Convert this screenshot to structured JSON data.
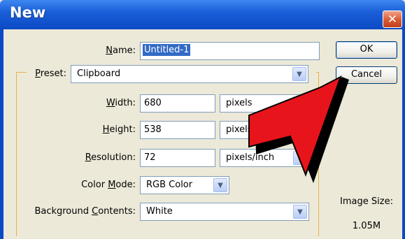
{
  "window": {
    "title": "New",
    "close_symbol": "✕"
  },
  "fields": {
    "name": {
      "label_prefix": "",
      "label_u": "N",
      "label_rest": "ame:",
      "value": "Untitled-1"
    },
    "preset": {
      "label_u": "P",
      "label_rest": "reset:",
      "value": "Clipboard"
    },
    "width": {
      "label_u": "W",
      "label_rest": "idth:",
      "value": "680",
      "unit": "pixels"
    },
    "height": {
      "label_u": "H",
      "label_rest": "eight:",
      "value": "538",
      "unit": "pixels"
    },
    "resolution": {
      "label_u": "R",
      "label_rest": "esolution:",
      "value": "72",
      "unit": "pixels/inch"
    },
    "color_mode": {
      "label_prefix": "Color ",
      "label_u": "M",
      "label_rest": "ode:",
      "value": "RGB Color"
    },
    "background": {
      "label_prefix": "Background ",
      "label_u": "C",
      "label_rest": "ontents:",
      "value": "White"
    }
  },
  "buttons": {
    "ok": "OK",
    "cancel": "Cancel"
  },
  "image_size": {
    "label": "Image Size:",
    "value": "1.05M"
  },
  "icons": {
    "dropdown_arrow": "chevron-down-icon",
    "overlay": "red-arrow-pointer"
  },
  "colors": {
    "titlebar": "#0b4ac4",
    "overlay_arrow": "#e8141b",
    "dialog_bg": "#ece9d8"
  }
}
